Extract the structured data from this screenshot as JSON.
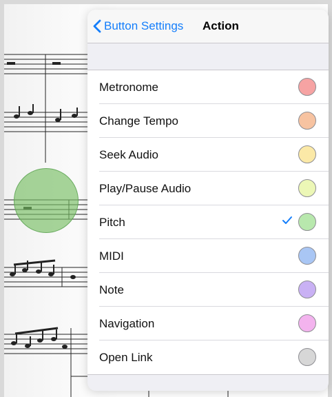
{
  "nav": {
    "back_label": "Button Settings",
    "title": "Action"
  },
  "colors": {
    "accent": "#147efb",
    "touch_circle": "#78be64"
  },
  "actions": [
    {
      "label": "Metronome",
      "color": "#f6a3a3",
      "selected": false
    },
    {
      "label": "Change Tempo",
      "color": "#f7c3a1",
      "selected": false
    },
    {
      "label": "Seek Audio",
      "color": "#fbe9a7",
      "selected": false
    },
    {
      "label": "Play/Pause Audio",
      "color": "#ecf7b6",
      "selected": false
    },
    {
      "label": "Pitch",
      "color": "#b8e8ad",
      "selected": true
    },
    {
      "label": "MIDI",
      "color": "#a9c6f4",
      "selected": false
    },
    {
      "label": "Note",
      "color": "#c9b1f4",
      "selected": false
    },
    {
      "label": "Navigation",
      "color": "#f3b3ee",
      "selected": false
    },
    {
      "label": "Open Link",
      "color": "#d7d7d7",
      "selected": false
    }
  ],
  "icons": {
    "back": "chevron-left-icon",
    "selected": "checkmark-icon"
  }
}
